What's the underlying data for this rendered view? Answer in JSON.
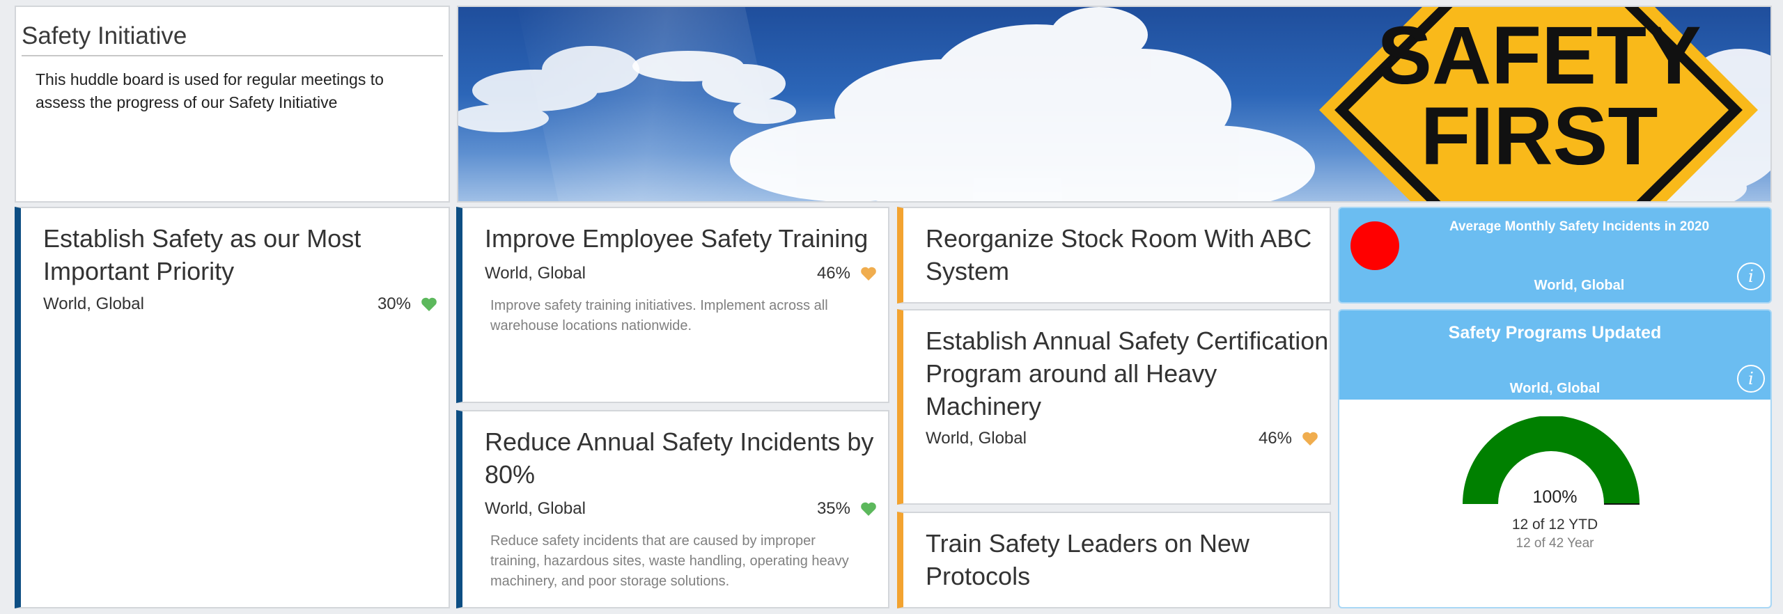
{
  "intro": {
    "title": "Safety Initiative",
    "description": "This huddle board is used for regular meetings to assess the progress of our Safety Initiative"
  },
  "banner": {
    "sign_line1": "SAFETY",
    "sign_line2": "FIRST"
  },
  "objectives": [
    {
      "title_line1": "Establish Safety as our Most",
      "title_line2": "Important Priority",
      "location": "World, Global",
      "percent": "30%",
      "status_icon": "heart-icon",
      "status_color": "#5cb85c",
      "description": ""
    },
    {
      "title_line1": "Improve Employee Safety Training",
      "title_line2": "",
      "location": "World, Global",
      "percent": "46%",
      "status_icon": "heart-icon",
      "status_color": "#f0ad4e",
      "description_line1": "Improve safety training initiatives. Implement across all",
      "description_line2": "warehouse locations nationwide."
    },
    {
      "title_line1": "Reduce Annual Safety Incidents by",
      "title_line2": "80%",
      "location": "World, Global",
      "percent": "35%",
      "status_icon": "heart-icon",
      "status_color": "#5cb85c",
      "description_line1": "Reduce safety incidents that are caused by improper",
      "description_line2": "training, hazardous sites, waste handling, operating heavy",
      "description_line3": "machinery, and poor storage solutions."
    },
    {
      "title_line1": "Reorganize Stock Room With ABC",
      "title_line2": "System"
    },
    {
      "title_line1": "Establish Annual Safety Certification",
      "title_line2": "Program around all Heavy",
      "title_line3": "Machinery",
      "location": "World, Global",
      "percent": "46%",
      "status_icon": "heart-icon",
      "status_color": "#f0ad4e"
    },
    {
      "title_line1": "Train Safety Leaders on New",
      "title_line2": "Protocols"
    }
  ],
  "metrics": [
    {
      "title": "Average Monthly Safety Incidents in 2020",
      "location": "World, Global",
      "indicator_color": "#ff0000",
      "info_label": "i"
    },
    {
      "title": "Safety Programs Updated",
      "location": "World, Global",
      "info_label": "i",
      "gauge_percent": "100%",
      "gauge_value": 1.0,
      "gauge_color": "#008000",
      "ytd": "12 of 12 YTD",
      "year": "12 of 42 Year"
    }
  ],
  "colors": {
    "accent_blue": "#0d4e83",
    "accent_orange": "#f3a330",
    "metric_bg": "#6bbdf1"
  }
}
